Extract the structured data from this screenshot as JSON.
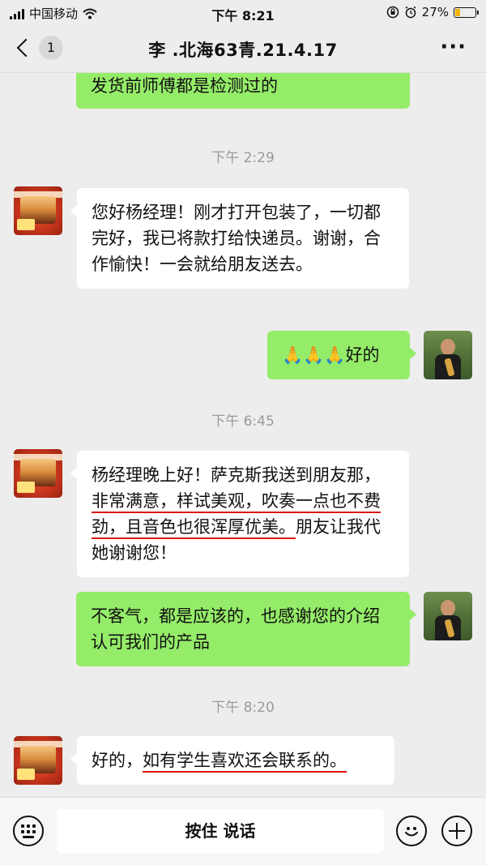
{
  "status_bar": {
    "carrier": "中国移动",
    "time": "下午 8:21",
    "battery": "27%",
    "battery_level": 0.27
  },
  "header": {
    "back_count": "1",
    "title": "李  .北海63青.21.4.17",
    "more": "···"
  },
  "messages": {
    "m0": {
      "text": "发货前师傅都是检测过的"
    },
    "t1": "下午 2:29",
    "m1": {
      "text": "您好杨经理！刚才打开包装了，一切都完好，我已将款打给快递员。谢谢，合作愉快！一会就给朋友送去。"
    },
    "m2": {
      "emoji": "🙏🙏🙏",
      "text": "好的"
    },
    "t2": "下午 6:45",
    "m3": {
      "p1": "杨经理晚上好！萨克斯我送到朋友那，",
      "u1": "非常满意，样试美观，",
      "u2": "吹奏一点也不费劲，且音色也很浑厚优美。",
      "p2": "朋友让我代她谢谢您！"
    },
    "m4": {
      "text": "不客气，都是应该的，也感谢您的介绍认可我们的产品"
    },
    "t3": "下午 8:20",
    "m5": {
      "p1": "好的，",
      "u1": "如有学生喜欢还会联系的。"
    }
  },
  "input_bar": {
    "voice_label": "按住 说话",
    "keyboard_icon": "keyboard-icon",
    "emoji_icon": "emoji-icon",
    "plus_icon": "plus-icon"
  }
}
